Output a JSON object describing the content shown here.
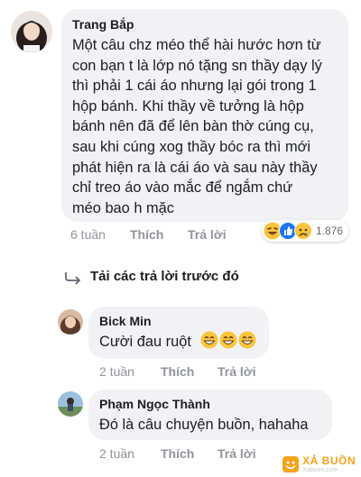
{
  "comment": {
    "author": "Trang Bắp",
    "text_lines": [
      "Một câu chz méo thể hài hước hơn từ",
      "con bạn t là lớp nó tặng sn thầy dạy lý",
      "thì phải 1 cái áo nhưng lại gói trong 1",
      "hộp bánh. Khi thầy về tưởng là hộp",
      "bánh nên đã để lên bàn thờ cúng cụ,",
      "sau khi cúng xog thầy bóc ra thì mới",
      "phát hiện ra là cái áo và sau này thầy",
      "chỉ treo áo vào mắc để ngắm chứ",
      "méo bao h mặc"
    ],
    "time": "6 tuần",
    "like_label": "Thích",
    "reply_label": "Trả lời",
    "reaction_count": "1.876",
    "reaction_icons": [
      "laugh-emoji",
      "like-emoji",
      "sad-emoji"
    ]
  },
  "load_previous": {
    "label": "Tải các trả lời trước đó",
    "icon": "reply-arrow-icon"
  },
  "replies": [
    {
      "author": "Bick Min",
      "text": "Cười đau ruột",
      "emoji_count": 3,
      "emoji": "grin-emoji",
      "time": "2 tuần",
      "like_label": "Thích",
      "reply_label": "Trả lời"
    },
    {
      "author": "Phạm Ngọc Thành",
      "text": "Đó là câu chuyện buồn, hahaha",
      "time": "2 tuần",
      "like_label": "Thích",
      "reply_label": "Trả lời"
    }
  ],
  "watermark": {
    "brand": "XẢ BUỒN",
    "url": "Xabuon.com"
  },
  "colors": {
    "bubble": "#f0f2f5",
    "meta_text": "#90949c",
    "watermark": "#f2a41c",
    "like_blue": "#1877f2",
    "emoji_yellow": "#fcc43a"
  }
}
